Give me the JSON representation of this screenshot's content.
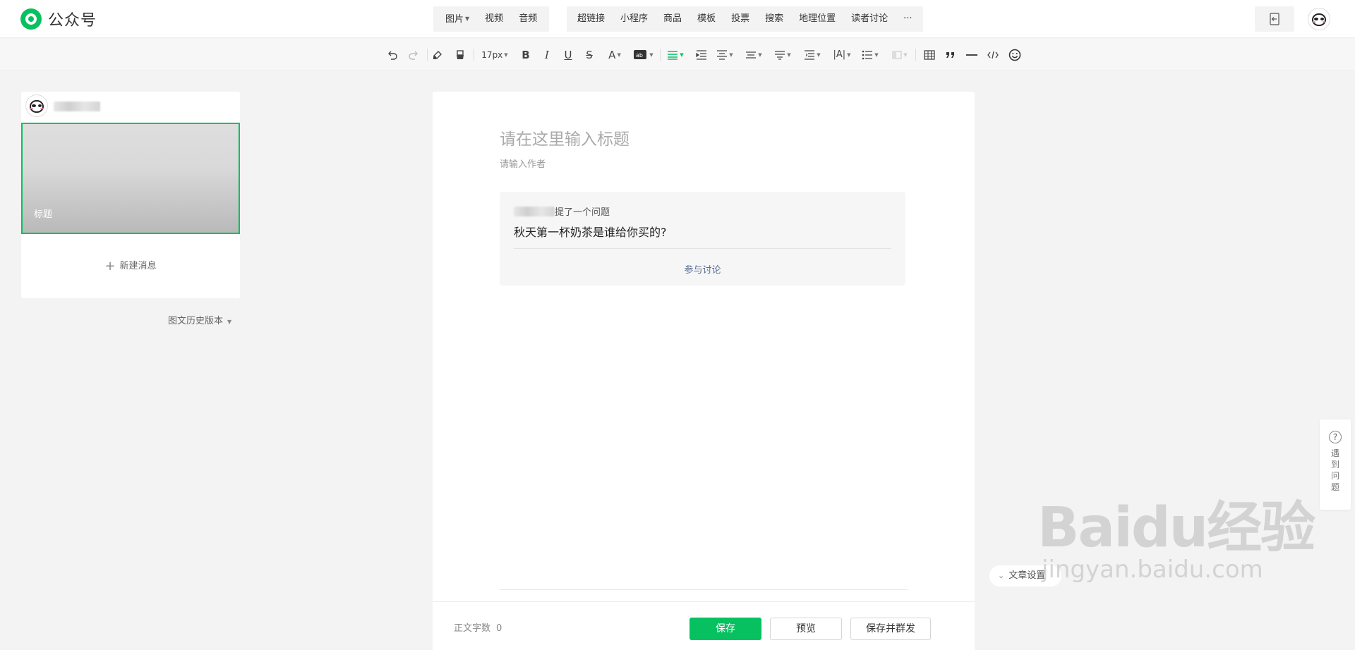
{
  "app": {
    "name": "公众号",
    "brand_color": "#07c160"
  },
  "top_toolbar": {
    "media": [
      {
        "label": "图片",
        "dropdown": true
      },
      {
        "label": "视频",
        "dropdown": false
      },
      {
        "label": "音频",
        "dropdown": false
      }
    ],
    "insert": [
      "超链接",
      "小程序",
      "商品",
      "模板",
      "投票",
      "搜索",
      "地理位置",
      "读者讨论"
    ],
    "more_label": "···",
    "right_icons": [
      "exit-icon",
      "avatar"
    ]
  },
  "format_toolbar": {
    "font_size": "17px",
    "bold": "B",
    "italic": "I",
    "underline": "U",
    "strike": "S",
    "font_color": "A",
    "letter_spacing": "|A|",
    "icons": [
      "undo-icon",
      "redo-icon",
      "format-brush-icon",
      "clear-format-icon",
      "text-background-icon",
      "align-left-icon",
      "indent-icon",
      "align-center-icon",
      "line-height-icon",
      "paragraph-spacing-icon",
      "first-line-indent-icon",
      "letter-spacing-icon",
      "list-icon",
      "disabled-option-icon",
      "table-icon",
      "quote-icon",
      "divider-icon",
      "code-icon",
      "emoji-icon"
    ]
  },
  "sidebar": {
    "cover_title": "标题",
    "new_message": "新建消息",
    "history": "图文历史版本"
  },
  "editor": {
    "title_placeholder": "请在这里输入标题",
    "author_placeholder": "请输入作者",
    "question_card": {
      "asker_suffix": "提了一个问题",
      "question": "秋天第一杯奶茶是谁给你买的?",
      "join_label": "参与讨论"
    }
  },
  "footer": {
    "word_count_label": "正文字数",
    "word_count": "0",
    "save": "保存",
    "preview": "预览",
    "save_publish": "保存并群发"
  },
  "article_settings": "文章设置",
  "help": "遇到问题",
  "watermark": {
    "logo": "Baidu经验",
    "url": "jingyan.baidu.com"
  }
}
